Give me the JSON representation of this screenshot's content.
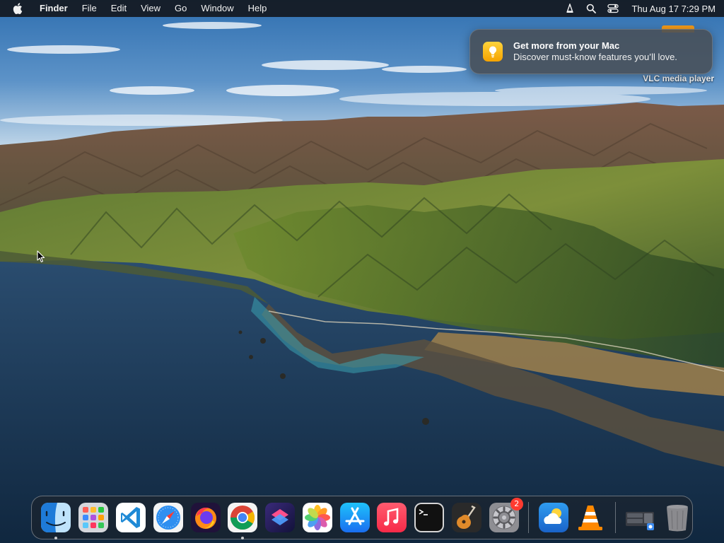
{
  "menubar": {
    "apple_icon": "apple-logo-icon",
    "app_name": "Finder",
    "menus": [
      "File",
      "Edit",
      "View",
      "Go",
      "Window",
      "Help"
    ],
    "status_icons": [
      "vlc-status-icon",
      "search-icon",
      "control-center-icon"
    ],
    "clock": "Thu Aug 17  7:29 PM"
  },
  "notification": {
    "icon": "lightbulb-icon",
    "title": "Get more from your Mac",
    "body": "Discover must-know features you’ll love."
  },
  "desktop": {
    "items": [
      {
        "label": "VLC media player",
        "icon": "vlc-file-icon"
      }
    ]
  },
  "dock": {
    "apps": [
      {
        "name": "Finder",
        "icon": "finder-icon",
        "running": true
      },
      {
        "name": "Launchpad",
        "icon": "launchpad-icon",
        "running": false
      },
      {
        "name": "Visual Studio Code",
        "icon": "vscode-icon",
        "running": false
      },
      {
        "name": "Safari",
        "icon": "safari-icon",
        "running": false
      },
      {
        "name": "Firefox",
        "icon": "firefox-icon",
        "running": false
      },
      {
        "name": "Google Chrome",
        "icon": "chrome-icon",
        "running": true
      },
      {
        "name": "Shortcuts",
        "icon": "shortcuts-icon",
        "running": false
      },
      {
        "name": "Photos",
        "icon": "photos-icon",
        "running": false
      },
      {
        "name": "App Store",
        "icon": "app-store-icon",
        "running": false
      },
      {
        "name": "Music",
        "icon": "music-icon",
        "running": false
      },
      {
        "name": "Terminal",
        "icon": "terminal-icon",
        "running": false
      },
      {
        "name": "GarageBand",
        "icon": "garageband-icon",
        "running": false
      },
      {
        "name": "System Preferences",
        "icon": "system-preferences-icon",
        "running": false,
        "badge": "2"
      }
    ],
    "recent_apps": [
      {
        "name": "Weather",
        "icon": "weather-icon"
      },
      {
        "name": "VLC",
        "icon": "vlc-icon"
      }
    ],
    "others": [
      {
        "name": "Downloads",
        "icon": "downloads-stack-icon"
      },
      {
        "name": "Trash",
        "icon": "trash-icon"
      }
    ]
  },
  "colors": {
    "menubar_bg": "#14181f",
    "notification_bg": "#484e56",
    "badge": "#ff3b30",
    "accent_orange": "#f29a1a"
  }
}
